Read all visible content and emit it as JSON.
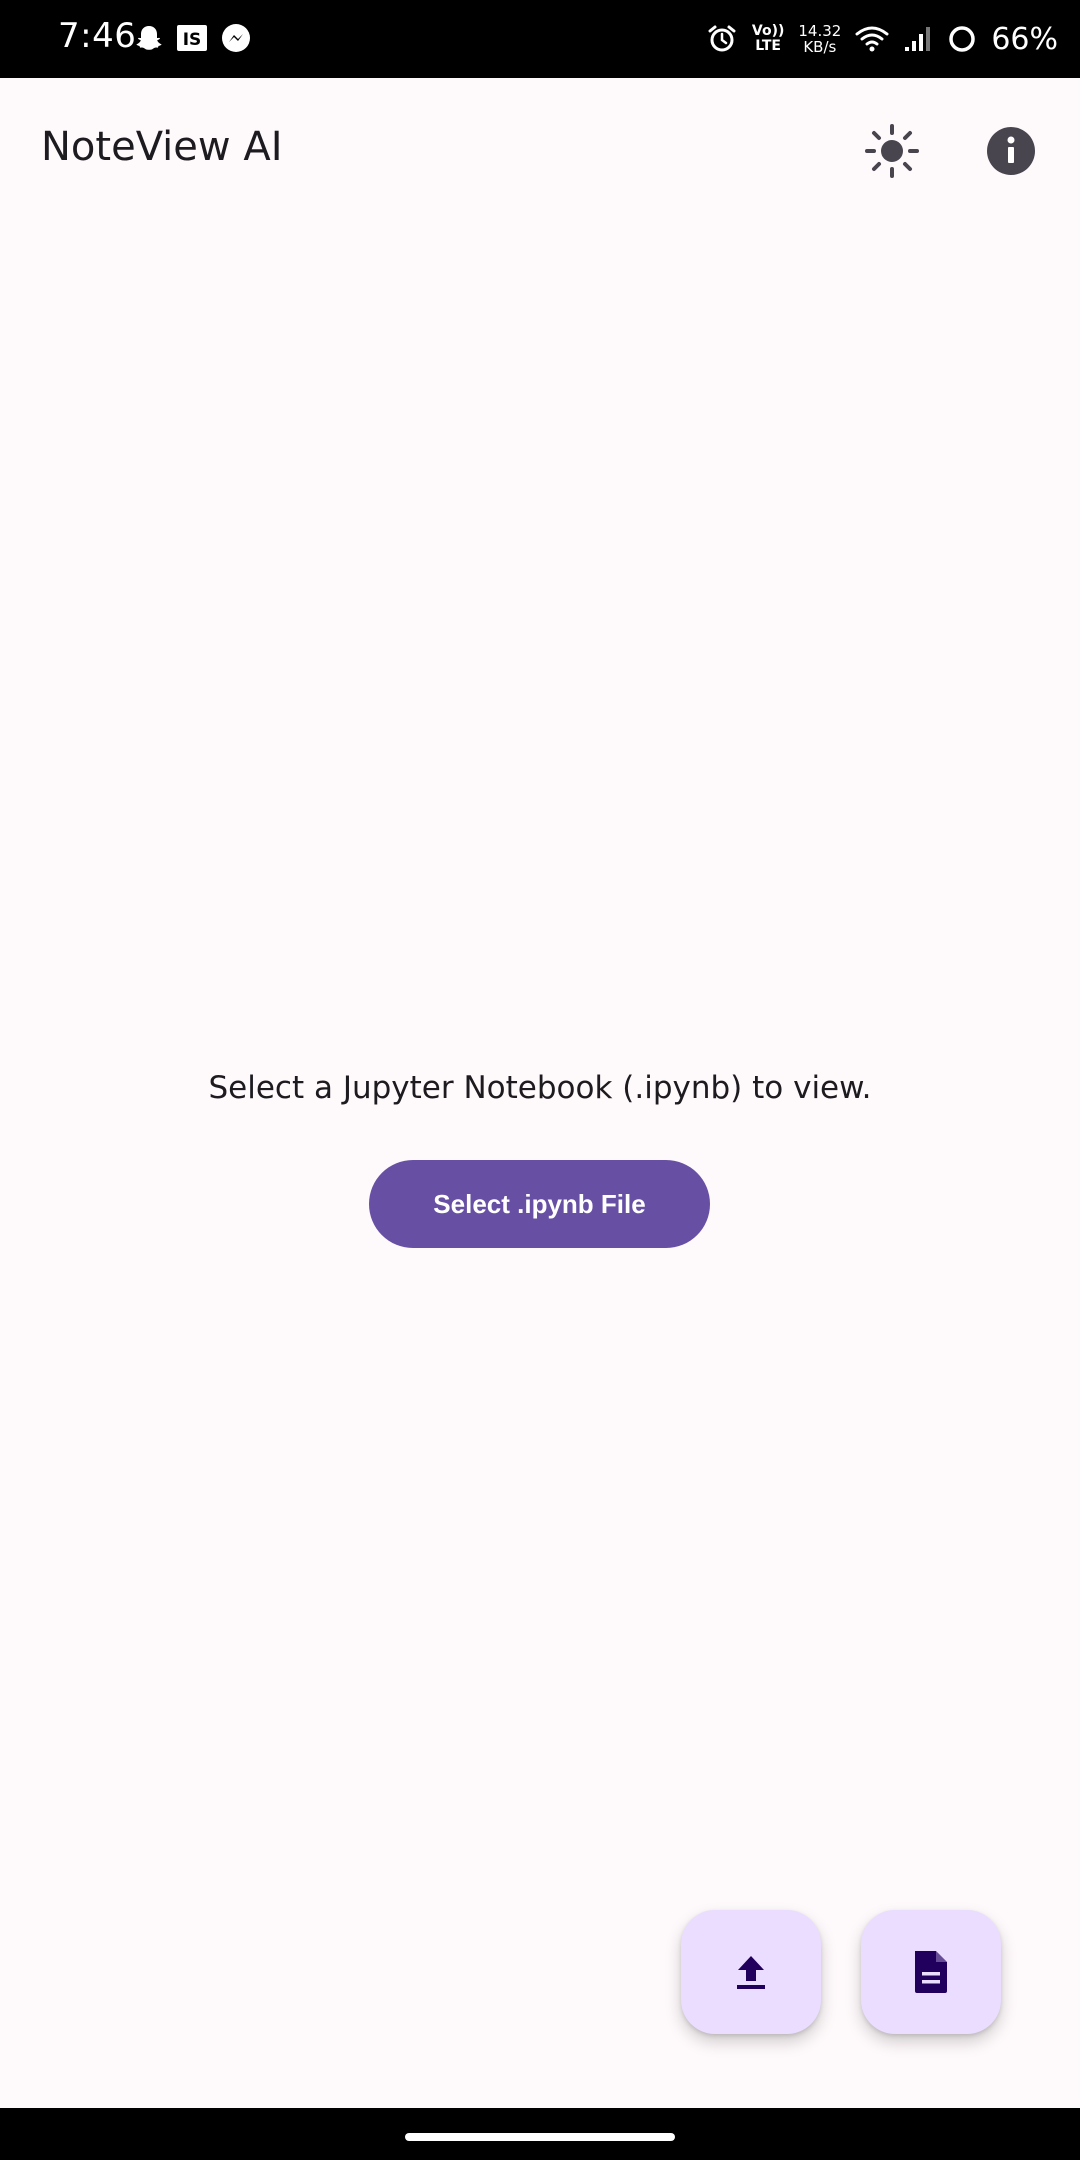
{
  "status_bar": {
    "time": "7:46",
    "left_icons": [
      "snapchat-icon",
      "is-app-icon",
      "messenger-icon"
    ],
    "is_label": "IS",
    "network_top": "Vo))",
    "network_bottom": "LTE",
    "speed_value": "14.32",
    "speed_unit": "KB/s",
    "battery": "66%"
  },
  "app_bar": {
    "title": "NoteView AI",
    "actions": [
      "brightness-icon",
      "info-icon"
    ]
  },
  "main": {
    "prompt": "Select a Jupyter Notebook (.ipynb) to view.",
    "select_button_label": "Select .ipynb File"
  },
  "fabs": [
    "upload-icon",
    "document-icon"
  ],
  "colors": {
    "background": "#FEF9FB",
    "primary": "#6750A4",
    "fab_container": "#EADDFF",
    "fab_icon": "#21005D",
    "on_surface": "#1D1B20",
    "icon_dark": "#49454F"
  }
}
